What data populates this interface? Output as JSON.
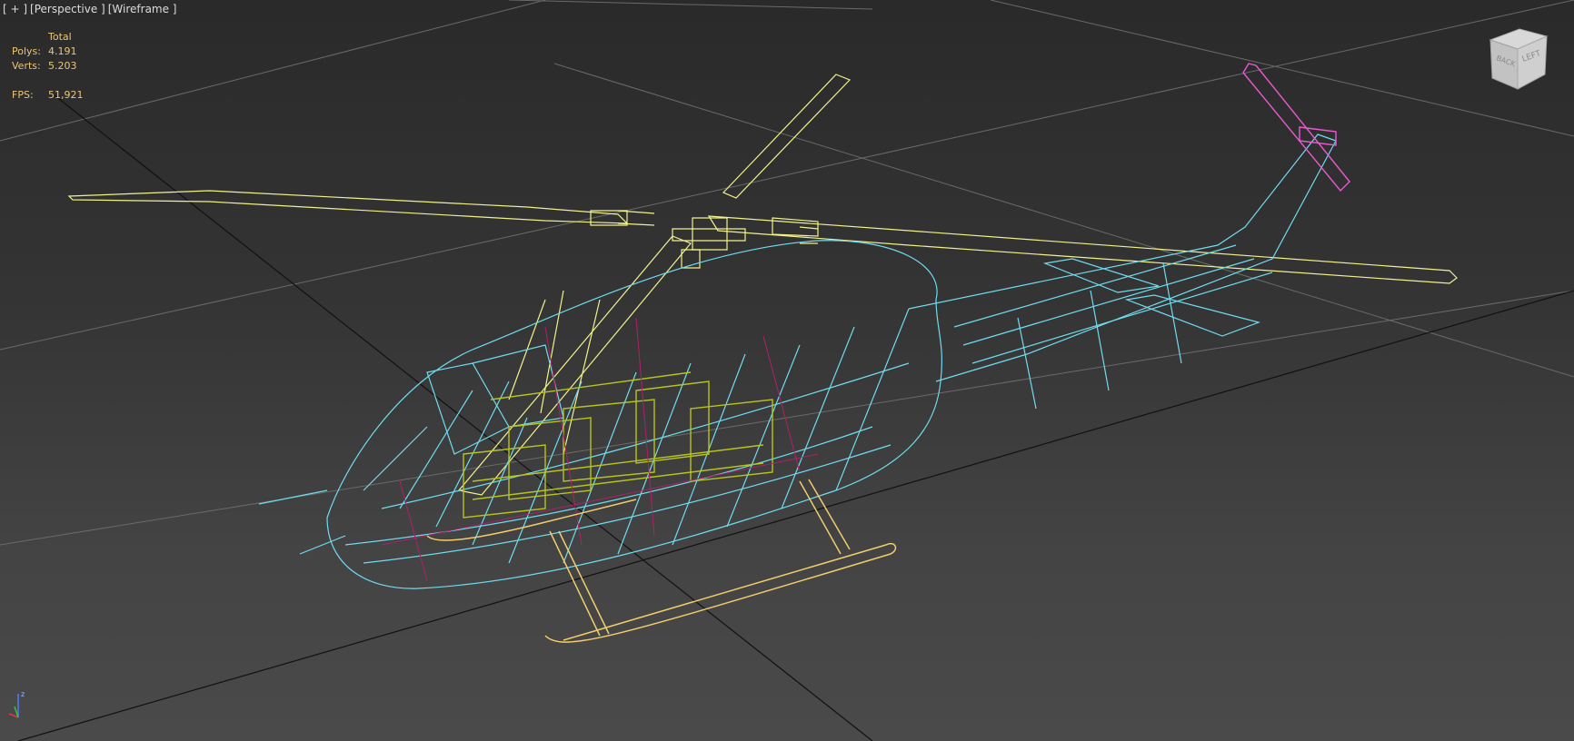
{
  "viewport": {
    "labels": [
      "[ + ]",
      "[Perspective ]",
      "[Wireframe ]"
    ]
  },
  "stats": {
    "header": "Total",
    "polys_label": "Polys:",
    "polys_value": "4.191",
    "verts_label": "Verts:",
    "verts_value": "5.203",
    "fps_label": "FPS:",
    "fps_value": "51,921"
  },
  "viewcube": {
    "back_label": "BACK",
    "left_label": "LEFT"
  },
  "axis_gizmo": {
    "z_label": "z"
  },
  "colors": {
    "background": "#2f2f2f",
    "grid": "#6b6b6b",
    "grid_axis": "#0d0d0d",
    "rotor_yellow": "#f2f28c",
    "fuselage_cyan": "#6fdcf0",
    "interior_yellow_green": "#b8c41a",
    "interior_magenta": "#b0206a",
    "tail_rotor_magenta": "#ea5ad2",
    "skid_orange_yellow": "#f2cd6c",
    "stats_text": "#e9c779"
  }
}
